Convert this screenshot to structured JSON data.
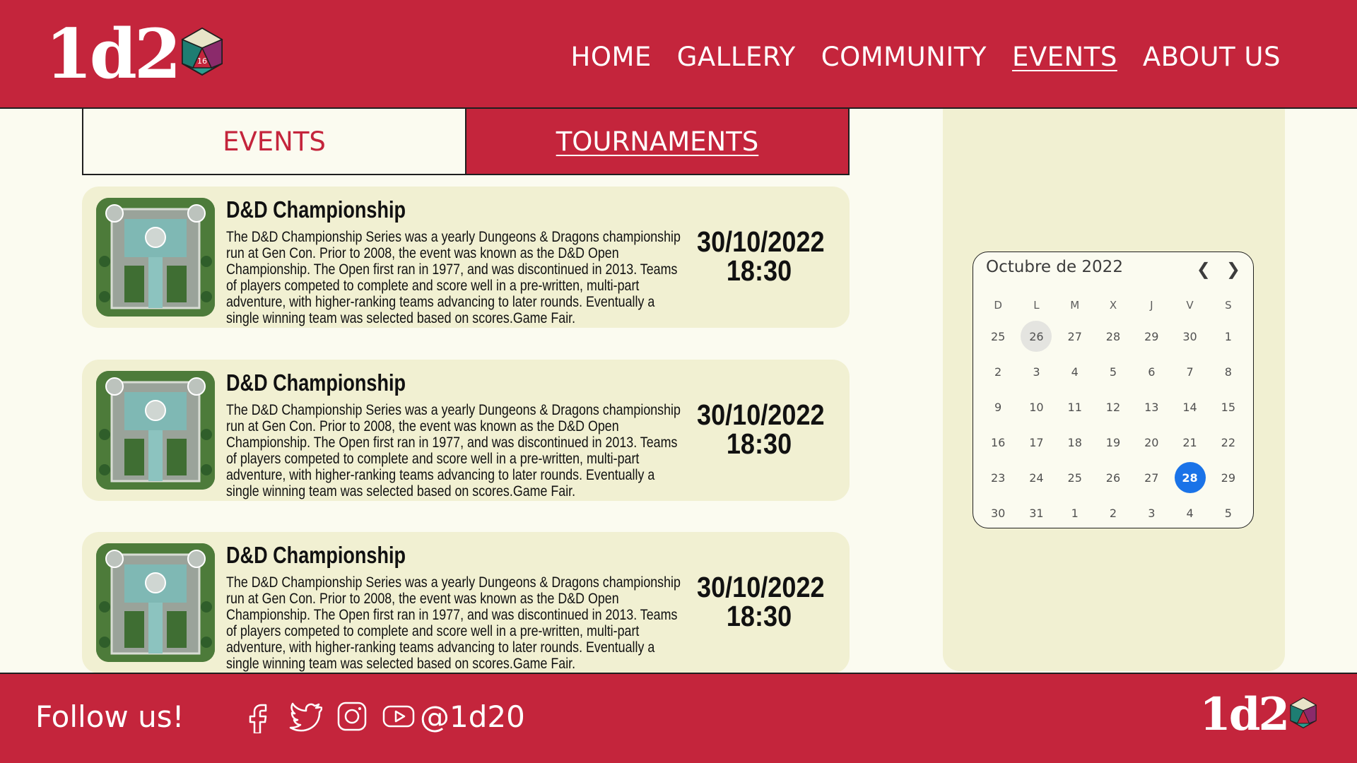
{
  "brand": {
    "logo_text": "1d2",
    "die_label": "16"
  },
  "nav": [
    {
      "label": "HOME"
    },
    {
      "label": "GALLERY"
    },
    {
      "label": "COMMUNITY"
    },
    {
      "label": "EVENTS",
      "active": true
    },
    {
      "label": "ABOUT US"
    }
  ],
  "tabs": {
    "events": "EVENTS",
    "tournaments": "TOURNAMENTS"
  },
  "events": [
    {
      "title": "D&D Championship",
      "description": "The D&D Championship Series was a yearly Dungeons & Dragons championship run at Gen Con. Prior to 2008, the event was known as the D&D Open Championship. The Open first ran in 1977, and was discontinued in 2013. Teams of players competed to complete and score well in a pre-written, multi-part adventure, with higher-ranking teams advancing to later rounds. Eventually a single winning team was selected based on scores.Game Fair.",
      "date": "30/10/2022",
      "time": "18:30"
    },
    {
      "title": "D&D Championship",
      "description": "The D&D Championship Series was a yearly Dungeons & Dragons championship run at Gen Con. Prior to 2008, the event was known as the D&D Open Championship. The Open first ran in 1977, and was discontinued in 2013. Teams of players competed to complete and score well in a pre-written, multi-part adventure, with higher-ranking teams advancing to later rounds. Eventually a single winning team was selected based on scores.Game Fair.",
      "date": "30/10/2022",
      "time": "18:30"
    },
    {
      "title": "D&D Championship",
      "description": "The D&D Championship Series was a yearly Dungeons & Dragons championship run at Gen Con. Prior to 2008, the event was known as the D&D Open Championship. The Open first ran in 1977, and was discontinued in 2013. Teams of players competed to complete and score well in a pre-written, multi-part adventure, with higher-ranking teams advancing to later rounds. Eventually a single winning team was selected based on scores.Game Fair.",
      "date": "30/10/2022",
      "time": "18:30"
    }
  ],
  "calendar": {
    "title": "Octubre de 2022",
    "prev_icon": "chevron-left-icon",
    "next_icon": "chevron-right-icon",
    "weekdays": [
      "D",
      "L",
      "M",
      "X",
      "J",
      "V",
      "S"
    ],
    "days": [
      "25",
      "26",
      "27",
      "28",
      "29",
      "30",
      "1",
      "2",
      "3",
      "4",
      "5",
      "6",
      "7",
      "8",
      "9",
      "10",
      "11",
      "12",
      "13",
      "14",
      "15",
      "16",
      "17",
      "18",
      "19",
      "20",
      "21",
      "22",
      "23",
      "24",
      "25",
      "26",
      "27",
      "28",
      "29",
      "30",
      "31",
      "1",
      "2",
      "3",
      "4",
      "5"
    ],
    "today_index": 1,
    "selected_index": 33,
    "selected_color": "#1a73e8"
  },
  "footer": {
    "follow": "Follow us!",
    "handle": "@1d20",
    "socials": [
      "facebook-icon",
      "twitter-icon",
      "instagram-icon",
      "youtube-icon"
    ]
  },
  "colors": {
    "brand_red": "#c4253c",
    "background": "#fbfbf0",
    "card": "#f1f0d2"
  }
}
